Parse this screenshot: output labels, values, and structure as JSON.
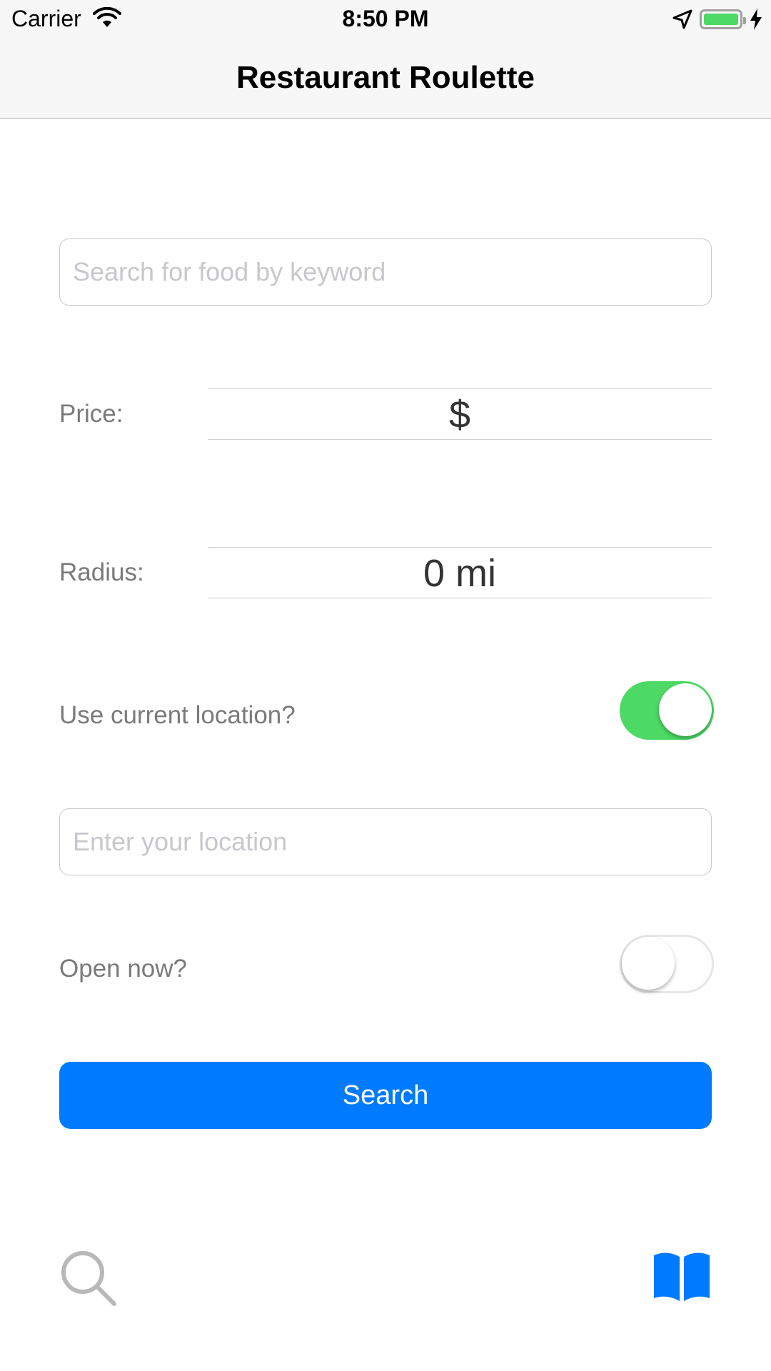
{
  "status_bar": {
    "carrier": "Carrier",
    "time": "8:50 PM",
    "battery_color": "#4cd964"
  },
  "nav": {
    "title": "Restaurant Roulette"
  },
  "form": {
    "keyword_placeholder": "Search for food by keyword",
    "keyword_value": "",
    "price_label": "Price:",
    "price_value": "$",
    "radius_label": "Radius:",
    "radius_value": "0 mi",
    "use_location_label": "Use current location?",
    "use_location_on": true,
    "location_placeholder": "Enter your location",
    "location_value": "",
    "open_now_label": "Open now?",
    "open_now_on": false,
    "search_button_label": "Search"
  },
  "tab_bar": {
    "items": [
      {
        "icon": "search-icon",
        "selected": false
      },
      {
        "icon": "book-icon",
        "selected": true
      }
    ],
    "accent_color": "#007aff",
    "inactive_color": "#b8b8b8"
  },
  "colors": {
    "switch_on": "#4cd964",
    "button": "#007aff"
  }
}
